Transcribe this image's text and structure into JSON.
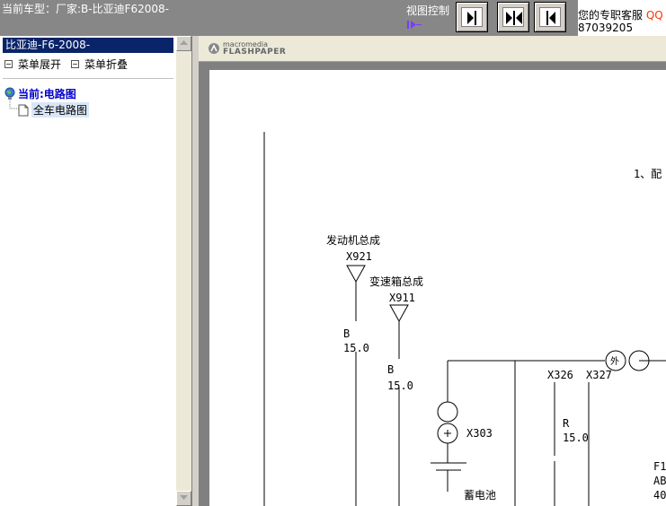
{
  "topbar": {
    "car_title": "当前车型：厂家:B-比亚迪F62008-",
    "view_control_label": "视图控制",
    "buttons": [
      {
        "name": "expand-right-button",
        "icon": "arrow-right-bar-icon"
      },
      {
        "name": "split-view-button",
        "icon": "arrows-inward-icon"
      },
      {
        "name": "expand-left-button",
        "icon": "arrow-left-bar-icon"
      }
    ],
    "customer_service": {
      "text": "您的专职客服",
      "qq_label": "QQ",
      "number": "87039205"
    }
  },
  "left_panel": {
    "title": "比亚迪-F6-2008-",
    "expand_label": "菜单展开",
    "collapse_label": "菜单折叠",
    "tree": {
      "root_label": "当前:电路图",
      "child_label": "全车电路图"
    }
  },
  "viewer": {
    "logo_small": "macromedia",
    "logo_main": "FLASHPAPER",
    "diagram": {
      "heading": "1、配",
      "labels": {
        "engine": "发动机总成",
        "x921": "X921",
        "trans": "变速箱总成",
        "x911": "X911",
        "b1": "B",
        "v1": "15.0",
        "b2": "B",
        "v2": "15.0",
        "x303": "X303",
        "battery": "蓄电池",
        "x326": "X326",
        "x327": "X327",
        "r": "R",
        "v3": "15.0",
        "wai": "外",
        "f1": "F1",
        "ab": "AB",
        "n40": "40"
      }
    }
  },
  "colors": {
    "topbar_bg": "#878787",
    "selection_bg": "#0a246a",
    "tree_root_text": "#0000cc",
    "qq_text": "#ff3300"
  }
}
